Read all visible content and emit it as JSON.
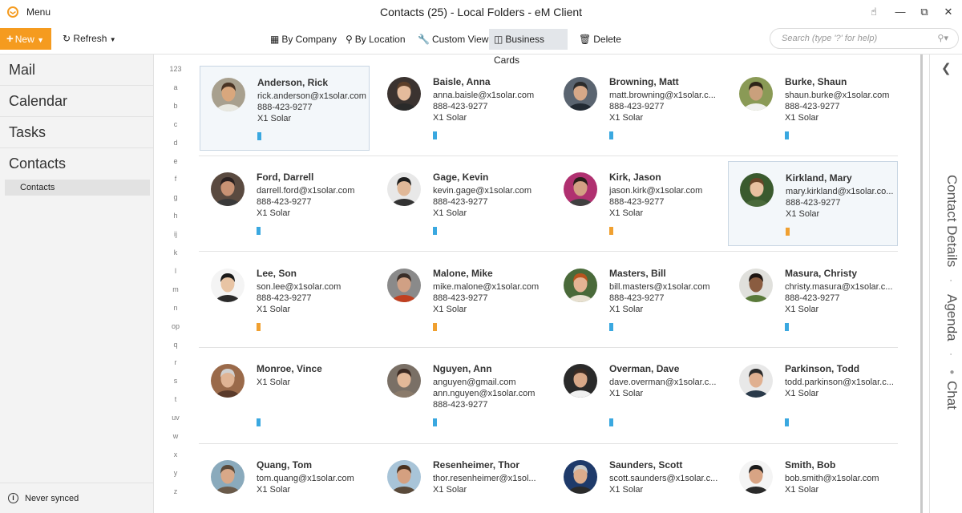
{
  "window": {
    "title": "Contacts (25) - Local Folders - eM Client",
    "menu_label": "Menu"
  },
  "toolbar": {
    "new_label": "New",
    "refresh_label": "Refresh",
    "by_company": "By Company",
    "by_location": "By Location",
    "custom_view": "Custom View",
    "business_cards": "Business Cards",
    "delete": "Delete",
    "search_placeholder": "Search (type '?' for help)"
  },
  "nav": {
    "items": [
      "Mail",
      "Calendar",
      "Tasks",
      "Contacts"
    ],
    "sub_item": "Contacts",
    "status": "Never synced"
  },
  "alphabet": [
    "123",
    "a",
    "b",
    "c",
    "d",
    "e",
    "f",
    "g",
    "h",
    "ij",
    "k",
    "l",
    "m",
    "n",
    "op",
    "q",
    "r",
    "s",
    "t",
    "uv",
    "w",
    "x",
    "y",
    "z"
  ],
  "contacts": [
    {
      "name": "Anderson, Rick",
      "lines": [
        "rick.anderson@x1solar.com",
        "888-423-9277",
        "X1 Solar"
      ],
      "tag": "#3aa8e0",
      "selected": true,
      "avatar": {
        "bg": "#a8a08e",
        "skin": "#d9a77d",
        "hair": "#4a3424",
        "shirt": "#e8e8e0"
      }
    },
    {
      "name": "Baisle, Anna",
      "lines": [
        "anna.baisle@x1solar.com",
        "888-423-9277",
        "X1 Solar"
      ],
      "tag": "#3aa8e0",
      "selected": false,
      "avatar": {
        "bg": "#3b3330",
        "skin": "#e4bb9c",
        "hair": "#5c3f2a",
        "shirt": "#2a2a2a"
      }
    },
    {
      "name": "Browning, Matt",
      "lines": [
        "matt.browning@x1solar.c...",
        "888-423-9277",
        "X1 Solar"
      ],
      "tag": "#3aa8e0",
      "selected": false,
      "avatar": {
        "bg": "#5a6470",
        "skin": "#d6a888",
        "hair": "#2b2b2b",
        "shirt": "#222a33"
      }
    },
    {
      "name": "Burke, Shaun",
      "lines": [
        "shaun.burke@x1solar.com",
        "888-423-9277",
        "X1 Solar"
      ],
      "tag": "#3aa8e0",
      "selected": false,
      "avatar": {
        "bg": "#8a9a56",
        "skin": "#caa07c",
        "hair": "#2e2418",
        "shirt": "#f0f0ee"
      }
    },
    {
      "name": "Ford, Darrell",
      "lines": [
        "darrell.ford@x1solar.com",
        "888-423-9277",
        "X1 Solar"
      ],
      "tag": "#3aa8e0",
      "selected": false,
      "avatar": {
        "bg": "#5a4a40",
        "skin": "#c89274",
        "hair": "#2a2020",
        "shirt": "#3a3a3a"
      }
    },
    {
      "name": "Gage, Kevin",
      "lines": [
        "kevin.gage@x1solar.com",
        "888-423-9277",
        "X1 Solar"
      ],
      "tag": "#3aa8e0",
      "selected": false,
      "avatar": {
        "bg": "#e8e8e8",
        "skin": "#e0b898",
        "hair": "#1e1e1e",
        "shirt": "#333333"
      }
    },
    {
      "name": "Kirk, Jason",
      "lines": [
        "jason.kirk@x1solar.com",
        "888-423-9277",
        "X1 Solar"
      ],
      "tag": "#f0a030",
      "selected": false,
      "avatar": {
        "bg": "#b03070",
        "skin": "#d4a084",
        "hair": "#2a1e1a",
        "shirt": "#404040"
      }
    },
    {
      "name": "Kirkland, Mary",
      "lines": [
        "mary.kirkland@x1solar.co...",
        "888-423-9277",
        "X1 Solar"
      ],
      "tag": "#f0a030",
      "selected": true,
      "avatar": {
        "bg": "#3a5a2e",
        "skin": "#e8c0a0",
        "hair": "#6a4428",
        "shirt": "#4a6a3a"
      }
    },
    {
      "name": "Lee, Son",
      "lines": [
        "son.lee@x1solar.com",
        "888-423-9277",
        "X1 Solar"
      ],
      "tag": "#f0a030",
      "selected": false,
      "avatar": {
        "bg": "#f4f4f4",
        "skin": "#e8c4a4",
        "hair": "#1a1a1a",
        "shirt": "#2a2a2a"
      }
    },
    {
      "name": "Malone, Mike",
      "lines": [
        "mike.malone@x1solar.com",
        "888-423-9277",
        "X1 Solar"
      ],
      "tag": "#f0a030",
      "selected": false,
      "avatar": {
        "bg": "#8a8a8a",
        "skin": "#d0a084",
        "hair": "#3a2e28",
        "shirt": "#c04020"
      }
    },
    {
      "name": "Masters, Bill",
      "lines": [
        "bill.masters@x1solar.com",
        "888-423-9277",
        "X1 Solar"
      ],
      "tag": "#3aa8e0",
      "selected": false,
      "avatar": {
        "bg": "#4a6a3a",
        "skin": "#e4b494",
        "hair": "#b8541e",
        "shirt": "#e8e0d0"
      }
    },
    {
      "name": "Masura, Christy",
      "lines": [
        "christy.masura@x1solar.c...",
        "888-423-9277",
        "X1 Solar"
      ],
      "tag": "#3aa8e0",
      "selected": false,
      "avatar": {
        "bg": "#e0e0dc",
        "skin": "#8a5c40",
        "hair": "#1e1612",
        "shirt": "#5a7a3a"
      }
    },
    {
      "name": "Monroe, Vince",
      "lines": [
        "X1 Solar"
      ],
      "tag": "#3aa8e0",
      "selected": false,
      "avatar": {
        "bg": "#9a6a4a",
        "skin": "#e0b494",
        "hair": "#d0d0d0",
        "shirt": "#5a3a2a"
      }
    },
    {
      "name": "Nguyen, Ann",
      "lines": [
        "anguyen@gmail.com",
        "ann.nguyen@x1solar.com",
        "888-423-9277"
      ],
      "tag": "#3aa8e0",
      "selected": false,
      "avatar": {
        "bg": "#7a7066",
        "skin": "#e2b898",
        "hair": "#3a2820",
        "shirt": "#8a7a6a"
      }
    },
    {
      "name": "Overman, Dave",
      "lines": [
        "dave.overman@x1solar.c...",
        "X1 Solar"
      ],
      "tag": "#3aa8e0",
      "selected": false,
      "avatar": {
        "bg": "#2a2a2a",
        "skin": "#d8a888",
        "hair": "#3a2a22",
        "shirt": "#f0f0f0"
      }
    },
    {
      "name": "Parkinson, Todd",
      "lines": [
        "todd.parkinson@x1solar.c...",
        "X1 Solar"
      ],
      "tag": "#3aa8e0",
      "selected": false,
      "avatar": {
        "bg": "#e8e8e8",
        "skin": "#e0b090",
        "hair": "#2a2a2a",
        "shirt": "#2a3a4a"
      }
    },
    {
      "name": "Quang, Tom",
      "lines": [
        "tom.quang@x1solar.com",
        "X1 Solar"
      ],
      "tag": "#3aa8e0",
      "selected": false,
      "avatar": {
        "bg": "#8aaabc",
        "skin": "#d8a888",
        "hair": "#5a4a3a",
        "shirt": "#6a5a4a"
      }
    },
    {
      "name": "Resenheimer, Thor",
      "lines": [
        "thor.resenheimer@x1sol...",
        "X1 Solar"
      ],
      "tag": "#3aa8e0",
      "selected": false,
      "avatar": {
        "bg": "#a8c4d8",
        "skin": "#d4a080",
        "hair": "#4a3220",
        "shirt": "#5a4a3a"
      }
    },
    {
      "name": "Saunders, Scott",
      "lines": [
        "scott.saunders@x1solar.c...",
        "X1 Solar"
      ],
      "tag": "#3aa8e0",
      "selected": false,
      "avatar": {
        "bg": "#1e3a6a",
        "skin": "#dcac8c",
        "hair": "#c8c8c8",
        "shirt": "#2a2a2a"
      }
    },
    {
      "name": "Smith, Bob",
      "lines": [
        "bob.smith@x1solar.com",
        "X1 Solar"
      ],
      "tag": "#3aa8e0",
      "selected": false,
      "avatar": {
        "bg": "#f4f4f4",
        "skin": "#d8a484",
        "hair": "#1a1a1a",
        "shirt": "#2a2a2a"
      }
    }
  ],
  "right_pane": {
    "labels": [
      "Contact Details",
      "Agenda",
      "Chat"
    ]
  },
  "colors": {
    "accent": "#f59b1f",
    "blue_tag": "#3aa8e0",
    "orange_tag": "#f0a030",
    "selected_bg": "#f3f7fa"
  }
}
